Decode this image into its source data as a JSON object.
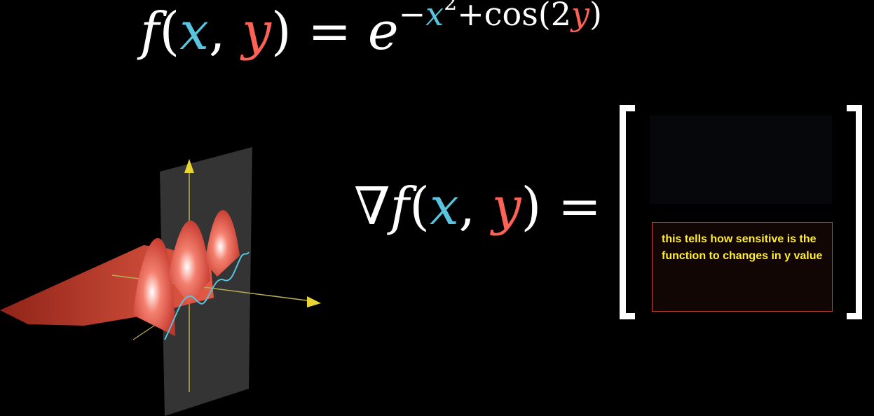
{
  "colors": {
    "x_variable": "#58c4dd",
    "y_variable": "#fc6255",
    "surface": "#f0604c",
    "axis_arrow": "#e8d534",
    "note_text": "#ffee33",
    "note_border": "#c2432f"
  },
  "top_formula": {
    "f": "f",
    "open": "(",
    "x": "x",
    "comma": ",",
    "y": "y",
    "close": ")",
    "equals": "=",
    "base": "e",
    "exp_minus": "−",
    "exp_x": "x",
    "exp_power": "2",
    "exp_plus_cos": "+cos(2",
    "exp_y": "y",
    "exp_close": ")"
  },
  "gradient_formula": {
    "nabla": "∇",
    "f": "f",
    "open": "(",
    "x": "x",
    "comma": ",",
    "y": "y",
    "close": ")",
    "equals": "="
  },
  "annotation": {
    "text": "this tells how sensitive is the function to changes in y value"
  },
  "plot": {
    "icons": [
      "surface-plot",
      "axis-arrow-up",
      "axis-arrow-right"
    ]
  }
}
